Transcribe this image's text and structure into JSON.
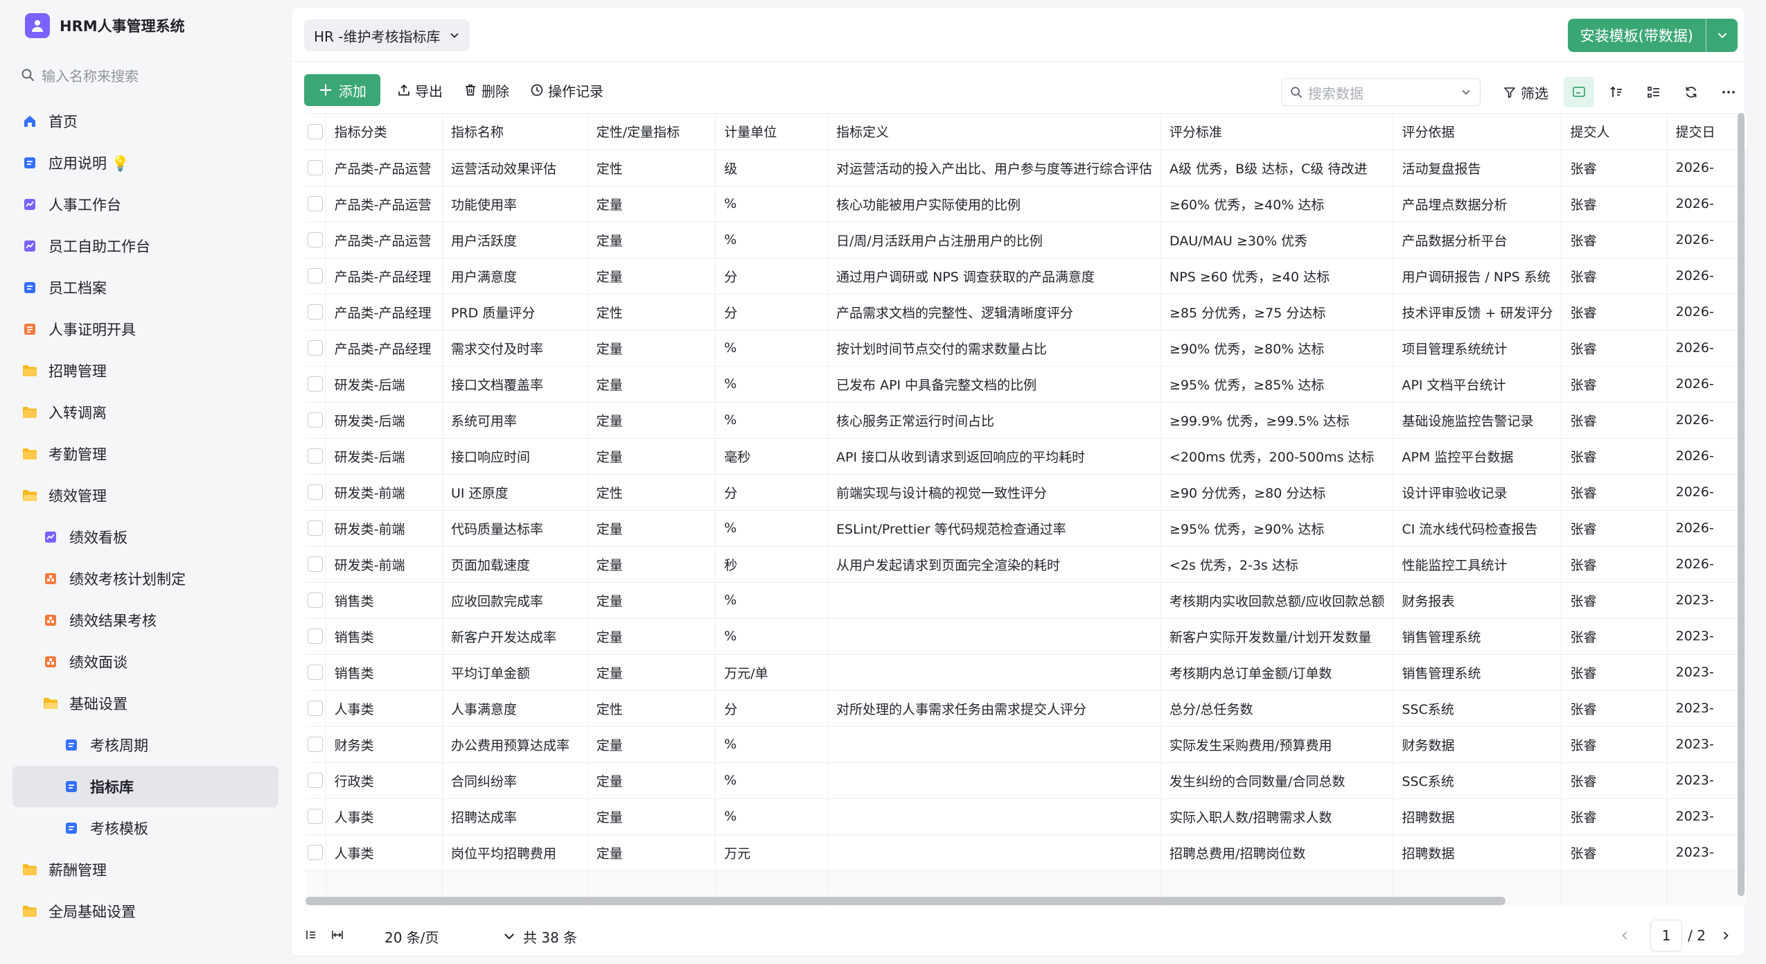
{
  "app": {
    "title": "HRM人事管理系统"
  },
  "sidebar": {
    "search_placeholder": "输入名称来搜索",
    "items": [
      {
        "label": "首页",
        "icon": "home-icon"
      },
      {
        "label": "应用说明 💡",
        "icon": "doc-icon"
      },
      {
        "label": "人事工作台",
        "icon": "dashboard-icon"
      },
      {
        "label": "员工自助工作台",
        "icon": "dashboard-icon"
      },
      {
        "label": "员工档案",
        "icon": "doc-icon"
      },
      {
        "label": "人事证明开具",
        "icon": "form-icon"
      },
      {
        "label": "招聘管理",
        "icon": "folder-icon"
      },
      {
        "label": "入转调离",
        "icon": "folder-icon"
      },
      {
        "label": "考勤管理",
        "icon": "folder-icon"
      },
      {
        "label": "绩效管理",
        "icon": "folder-open-icon"
      },
      {
        "label": "绩效看板",
        "icon": "dashboard-icon"
      },
      {
        "label": "绩效考核计划制定",
        "icon": "process-icon"
      },
      {
        "label": "绩效结果考核",
        "icon": "process-icon"
      },
      {
        "label": "绩效面谈",
        "icon": "process-icon"
      },
      {
        "label": "基础设置",
        "icon": "folder-open-icon"
      },
      {
        "label": "考核周期",
        "icon": "doc-icon"
      },
      {
        "label": "指标库",
        "icon": "doc-icon"
      },
      {
        "label": "考核模板",
        "icon": "doc-icon"
      },
      {
        "label": "薪酬管理",
        "icon": "folder-icon"
      },
      {
        "label": "全局基础设置",
        "icon": "folder-icon"
      }
    ]
  },
  "header": {
    "view_name": "HR -维护考核指标库",
    "install_label": "安装模板(带数据)"
  },
  "toolbar": {
    "add": "添加",
    "export": "导出",
    "delete": "删除",
    "log": "操作记录",
    "search_placeholder": "搜索数据",
    "filter": "筛选"
  },
  "table": {
    "columns": [
      "指标分类",
      "指标名称",
      "定性/定量指标",
      "计量单位",
      "指标定义",
      "评分标准",
      "评分依据",
      "提交人",
      "提交日"
    ],
    "rows": [
      [
        "产品类-产品运营",
        "运营活动效果评估",
        "定性",
        "级",
        "对运营活动的投入产出比、用户参与度等进行综合评估",
        "A级 优秀，B级 达标，C级 待改进",
        "活动复盘报告",
        "张睿",
        "2026-"
      ],
      [
        "产品类-产品运营",
        "功能使用率",
        "定量",
        "%",
        "核心功能被用户实际使用的比例",
        "≥60% 优秀，≥40% 达标",
        "产品埋点数据分析",
        "张睿",
        "2026-"
      ],
      [
        "产品类-产品运营",
        "用户活跃度",
        "定量",
        "%",
        "日/周/月活跃用户占注册用户的比例",
        "DAU/MAU ≥30% 优秀",
        "产品数据分析平台",
        "张睿",
        "2026-"
      ],
      [
        "产品类-产品经理",
        "用户满意度",
        "定量",
        "分",
        "通过用户调研或 NPS 调查获取的产品满意度",
        "NPS ≥60 优秀，≥40 达标",
        "用户调研报告 / NPS 系统",
        "张睿",
        "2026-"
      ],
      [
        "产品类-产品经理",
        "PRD 质量评分",
        "定性",
        "分",
        "产品需求文档的完整性、逻辑清晰度评分",
        "≥85 分优秀，≥75 分达标",
        "技术评审反馈 + 研发评分",
        "张睿",
        "2026-"
      ],
      [
        "产品类-产品经理",
        "需求交付及时率",
        "定量",
        "%",
        "按计划时间节点交付的需求数量占比",
        "≥90% 优秀，≥80% 达标",
        "项目管理系统统计",
        "张睿",
        "2026-"
      ],
      [
        "研发类-后端",
        "接口文档覆盖率",
        "定量",
        "%",
        "已发布 API 中具备完整文档的比例",
        "≥95% 优秀，≥85% 达标",
        "API 文档平台统计",
        "张睿",
        "2026-"
      ],
      [
        "研发类-后端",
        "系统可用率",
        "定量",
        "%",
        "核心服务正常运行时间占比",
        "≥99.9% 优秀，≥99.5% 达标",
        "基础设施监控告警记录",
        "张睿",
        "2026-"
      ],
      [
        "研发类-后端",
        "接口响应时间",
        "定量",
        "毫秒",
        "API 接口从收到请求到返回响应的平均耗时",
        "<200ms 优秀，200-500ms 达标",
        "APM 监控平台数据",
        "张睿",
        "2026-"
      ],
      [
        "研发类-前端",
        "UI 还原度",
        "定性",
        "分",
        "前端实现与设计稿的视觉一致性评分",
        "≥90 分优秀，≥80 分达标",
        "设计评审验收记录",
        "张睿",
        "2026-"
      ],
      [
        "研发类-前端",
        "代码质量达标率",
        "定量",
        "%",
        "ESLint/Prettier 等代码规范检查通过率",
        "≥95% 优秀，≥90% 达标",
        "CI 流水线代码检查报告",
        "张睿",
        "2026-"
      ],
      [
        "研发类-前端",
        "页面加载速度",
        "定量",
        "秒",
        "从用户发起请求到页面完全渲染的耗时",
        "<2s 优秀，2-3s 达标",
        "性能监控工具统计",
        "张睿",
        "2026-"
      ],
      [
        "销售类",
        "应收回款完成率",
        "定量",
        "%",
        "",
        "考核期内实收回款总额/应收回款总额",
        "财务报表",
        "张睿",
        "2023-"
      ],
      [
        "销售类",
        "新客户开发达成率",
        "定量",
        "%",
        "",
        "新客户实际开发数量/计划开发数量",
        "销售管理系统",
        "张睿",
        "2023-"
      ],
      [
        "销售类",
        "平均订单金额",
        "定量",
        "万元/单",
        "",
        "考核期内总订单金额/订单数",
        "销售管理系统",
        "张睿",
        "2023-"
      ],
      [
        "人事类",
        "人事满意度",
        "定性",
        "分",
        "对所处理的人事需求任务由需求提交人评分",
        "总分/总任务数",
        "SSC系统",
        "张睿",
        "2023-"
      ],
      [
        "财务类",
        "办公费用预算达成率",
        "定量",
        "%",
        "",
        "实际发生采购费用/预算费用",
        "财务数据",
        "张睿",
        "2023-"
      ],
      [
        "行政类",
        "合同纠纷率",
        "定量",
        "%",
        "",
        "发生纠纷的合同数量/合同总数",
        "SSC系统",
        "张睿",
        "2023-"
      ],
      [
        "人事类",
        "招聘达成率",
        "定量",
        "%",
        "",
        "实际入职人数/招聘需求人数",
        "招聘数据",
        "张睿",
        "2023-"
      ],
      [
        "人事类",
        "岗位平均招聘费用",
        "定量",
        "万元",
        "",
        "招聘总费用/招聘岗位数",
        "招聘数据",
        "张睿",
        "2023-"
      ]
    ]
  },
  "footer": {
    "page_size": "20 条/页",
    "total": "共 38 条",
    "current_page": "1",
    "page_count": "/ 2"
  },
  "colors": {
    "accent": "#3ba775",
    "brand": "#7b61ff",
    "nav_active": "#e4e6eb"
  }
}
